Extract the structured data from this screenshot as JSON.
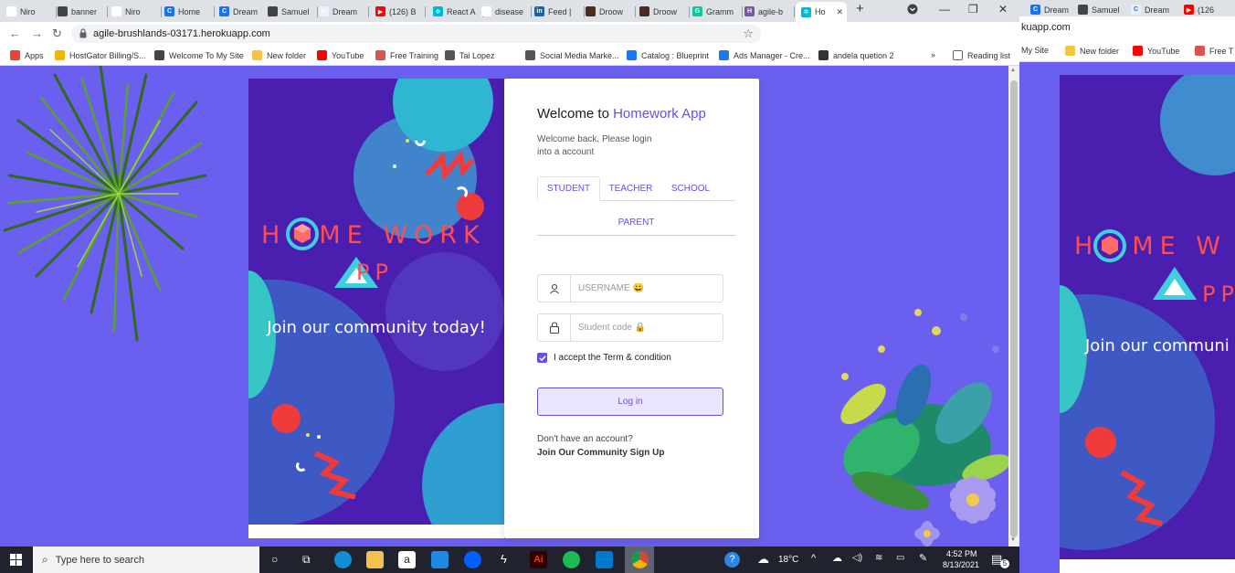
{
  "browser": {
    "tabs": [
      {
        "label": "Niro",
        "fav_color": "#ffffff",
        "fav_text": "N"
      },
      {
        "label": "banner",
        "fav_color": "#444444",
        "fav_text": ""
      },
      {
        "label": "Niro",
        "fav_color": "#ffffff",
        "fav_text": "N"
      },
      {
        "label": "Home",
        "fav_color": "#1a73e8",
        "fav_text": "C"
      },
      {
        "label": "Dream",
        "fav_color": "#1a73e8",
        "fav_text": "C"
      },
      {
        "label": "Samuel",
        "fav_color": "#444444",
        "fav_text": ""
      },
      {
        "label": "Dream",
        "fav_color": "#e8f0fe",
        "fav_text": "C"
      },
      {
        "label": "(126) B",
        "fav_color": "#ff0000",
        "fav_text": "▶"
      },
      {
        "label": "React A",
        "fav_color": "#00b7d6",
        "fav_text": "✲"
      },
      {
        "label": "disease",
        "fav_color": "#ffffff",
        "fav_text": "G"
      },
      {
        "label": "Feed |",
        "fav_color": "#0a66c2",
        "fav_text": "in"
      },
      {
        "label": "Droow",
        "fav_color": "#4a2c20",
        "fav_text": ""
      },
      {
        "label": "Droow",
        "fav_color": "#4a2c20",
        "fav_text": ""
      },
      {
        "label": "Gramm",
        "fav_color": "#15c39a",
        "fav_text": "G"
      },
      {
        "label": "agile-b",
        "fav_color": "#79589f",
        "fav_text": "H"
      }
    ],
    "active_tab": {
      "label": "Ho",
      "fav_color": "#00b7d6",
      "fav_text": "✲"
    },
    "new_tab": "+",
    "url": "agile-brushlands-03171.herokuapp.com",
    "bookmarks": [
      {
        "label": "Apps",
        "color": "#ea4335"
      },
      {
        "label": "HostGator Billing/S...",
        "color": "#f4b400"
      },
      {
        "label": "Welcome To My Site",
        "color": "#444444"
      },
      {
        "label": "New folder",
        "color": "#f6c443"
      },
      {
        "label": "YouTube",
        "color": "#ff0000"
      },
      {
        "label": "Free Training",
        "color": "#d9534f"
      },
      {
        "label": "Tai Lopez",
        "color": "#555555"
      },
      {
        "label": "Social Media Marke...",
        "color": "#555555"
      },
      {
        "label": "Catalog : Blueprint",
        "color": "#1877f2"
      },
      {
        "label": "Ads Manager - Cre...",
        "color": "#1877f2"
      },
      {
        "label": "andela quetion 2",
        "color": "#333333"
      }
    ],
    "reading_list": "Reading list",
    "overflow": "»"
  },
  "hero": {
    "title_letters": [
      "H",
      "O",
      "M",
      "E",
      " ",
      "W",
      "O",
      "R",
      "K"
    ],
    "title": "H   ME WORK",
    "app_suffix": "PP",
    "subtitle": "Join our community today!"
  },
  "login": {
    "welcome": "Welcome to ",
    "brand": "Homework App",
    "subtext": "Welcome back, Please login into a account",
    "tabs": [
      {
        "label": "STUDENT",
        "active": true
      },
      {
        "label": "TEACHER",
        "active": false
      },
      {
        "label": "SCHOOL",
        "active": false
      },
      {
        "label": "PARENT",
        "active": false
      }
    ],
    "username_placeholder": "USERNAME 😀",
    "code_placeholder": "Student code 🔒",
    "terms": "I accept the Term & condition",
    "terms_checked": true,
    "login_button": "Log in",
    "no_account": "Don't have an account?",
    "signup": "Join Our Community Sign Up",
    "accent": "#6b4ce6"
  },
  "second_window": {
    "tabs": [
      "Dream",
      "Samuel",
      "Dream",
      "(126"
    ],
    "url": "kuapp.com",
    "bookmarks": [
      "My Site",
      "New folder",
      "YouTube",
      "Free T"
    ],
    "hero_title": "HOME W",
    "hero_app": "PP",
    "hero_sub": "Join our communi"
  },
  "taskbar": {
    "search_placeholder": "Type here to search",
    "temperature": "18°C",
    "time": "4:52 PM",
    "date": "8/13/2021",
    "notifications": "5"
  }
}
